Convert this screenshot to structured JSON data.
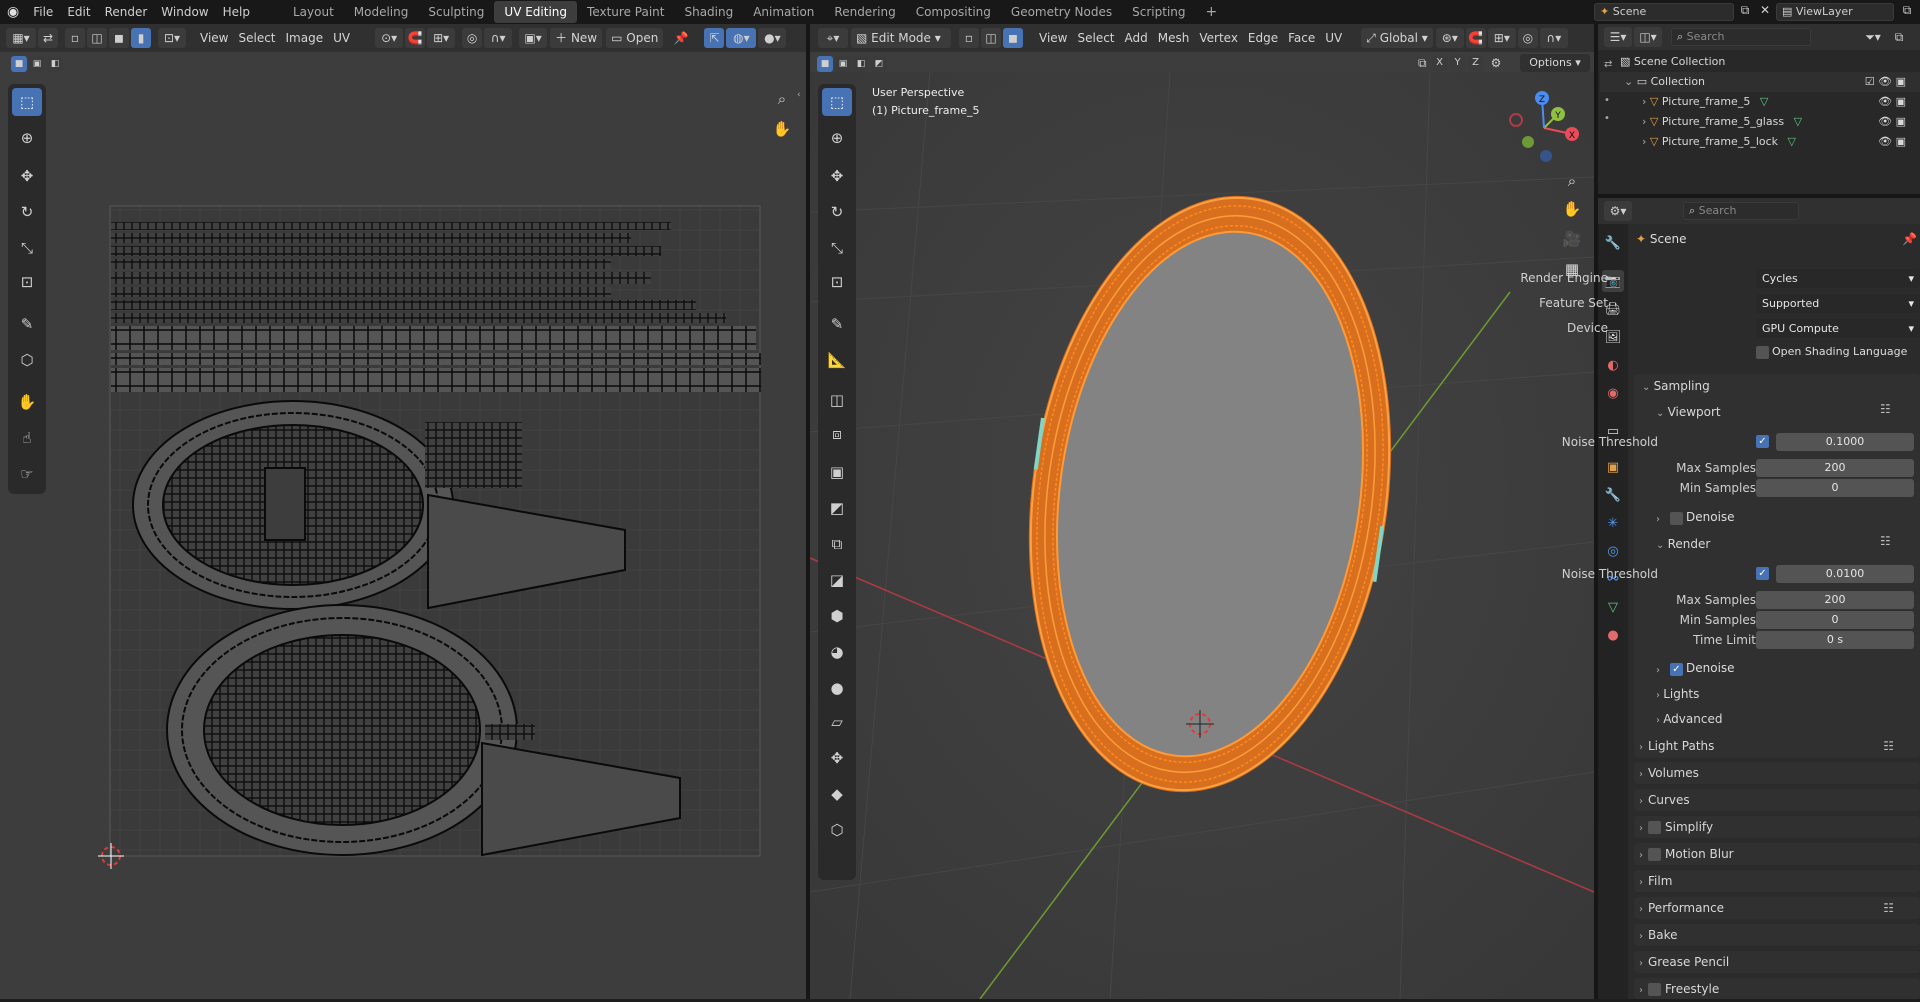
{
  "topbar": {
    "menus": [
      "File",
      "Edit",
      "Render",
      "Window",
      "Help"
    ],
    "workspaces": [
      "Layout",
      "Modeling",
      "Sculpting",
      "UV Editing",
      "Texture Paint",
      "Shading",
      "Animation",
      "Rendering",
      "Compositing",
      "Geometry Nodes",
      "Scripting"
    ],
    "active_workspace": "UV Editing",
    "add_tab": "+",
    "scene": "Scene",
    "view_layer": "ViewLayer"
  },
  "uv_editor": {
    "menus": [
      "View",
      "Select",
      "Image",
      "UV"
    ],
    "new_label": "New",
    "open_label": "Open"
  },
  "viewport": {
    "mode": "Edit Mode",
    "menus": [
      "View",
      "Select",
      "Add",
      "Mesh",
      "Vertex",
      "Edge",
      "Face",
      "UV"
    ],
    "orientation": "Global",
    "axes": [
      "X",
      "Y",
      "Z"
    ],
    "options_label": "Options",
    "info_line1": "User Perspective",
    "info_line2": "(1) Picture_frame_5",
    "gizmo": {
      "x": "X",
      "y": "Y",
      "z": "Z"
    }
  },
  "outliner": {
    "search_placeholder": "Search",
    "scene_collection": "Scene Collection",
    "collection": "Collection",
    "objects": [
      "Picture_frame_5",
      "Picture_frame_5_glass",
      "Picture_frame_5_lock"
    ]
  },
  "properties": {
    "search_placeholder": "Search",
    "context": "Scene",
    "render_engine_label": "Render Engine",
    "render_engine": "Cycles",
    "feature_set_label": "Feature Set",
    "feature_set": "Supported",
    "device_label": "Device",
    "device": "GPU Compute",
    "osl_label": "Open Shading Language",
    "sampling": "Sampling",
    "viewport_sub": "Viewport",
    "noise_threshold_label": "Noise Threshold",
    "viewport_noise_threshold": "0.1000",
    "max_samples_label": "Max Samples",
    "viewport_max_samples": "200",
    "min_samples_label": "Min Samples",
    "viewport_min_samples": "0",
    "denoise_label": "Denoise",
    "render_sub": "Render",
    "render_noise_threshold": "0.0100",
    "render_max_samples": "200",
    "render_min_samples": "0",
    "time_limit_label": "Time Limit",
    "render_time_limit": "0 s",
    "lights": "Lights",
    "advanced": "Advanced",
    "panels": [
      "Light Paths",
      "Volumes",
      "Curves",
      "Simplify",
      "Motion Blur",
      "Film",
      "Performance",
      "Bake",
      "Grease Pencil",
      "Freestyle"
    ]
  },
  "colors": {
    "accent": "#4772b3",
    "selection_orange": "#ff8a1e",
    "panel_bg": "#303030",
    "editor_bg": "#3d3d3d"
  }
}
